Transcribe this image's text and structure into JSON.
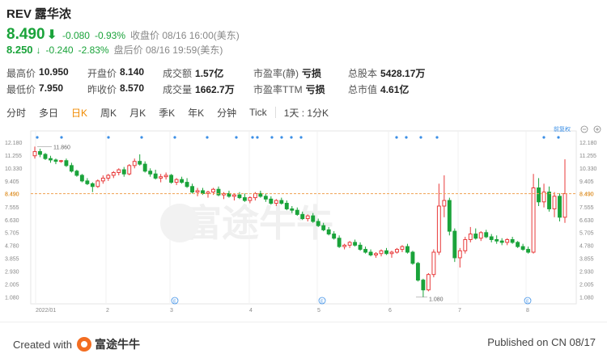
{
  "header": {
    "ticker": "REV",
    "name": "露华浓"
  },
  "quote": {
    "price": "8.490",
    "arrow": "⬇",
    "change": "-0.080",
    "change_pct": "-0.93%",
    "close_label": "收盘价 08/16 16:00(美东)",
    "ah_price": "8.250",
    "ah_arrow": "↓",
    "ah_change": "-0.240",
    "ah_change_pct": "-2.83%",
    "ah_label": "盘后价 08/16 19:59(美东)"
  },
  "stats": {
    "high_label": "最高价",
    "high": "10.950",
    "low_label": "最低价",
    "low": "7.950",
    "open_label": "开盘价",
    "open": "8.140",
    "prev_label": "昨收价",
    "prev": "8.570",
    "turnover_label": "成交额",
    "turnover": "1.57亿",
    "volume_label": "成交量",
    "volume": "1662.7万",
    "pe_static_label": "市盈率(静)",
    "pe_static": "亏损",
    "pe_ttm_label": "市盈率TTM",
    "pe_ttm": "亏损",
    "shares_label": "总股本",
    "shares": "5428.17万",
    "mcap_label": "总市值",
    "mcap": "4.61亿"
  },
  "tabs": [
    "分时",
    "多日",
    "日K",
    "周K",
    "月K",
    "季K",
    "年K",
    "分钟",
    "Tick",
    "1天 : 1分K"
  ],
  "active_tab": "日K",
  "colors": {
    "up": "#e83a3a",
    "down": "#1aa33a",
    "ref_line": "#f0a050",
    "accent": "#f08a00"
  },
  "chart_data": {
    "type": "candlestick",
    "y_ticks": [
      "12.180",
      "11.255",
      "10.330",
      "9.405",
      "8.490",
      "7.555",
      "6.630",
      "5.705",
      "4.780",
      "3.855",
      "2.930",
      "2.005",
      "1.080"
    ],
    "ylim": [
      0.6,
      12.4
    ],
    "x_labels": [
      "2022/01",
      "2",
      "3",
      "4",
      "5",
      "6",
      "7",
      "8"
    ],
    "current_price": 8.49,
    "current_price_label": "8.490",
    "max_annotation": "11.860",
    "min_annotation": "1.080",
    "adjust_label": "前复权",
    "event_marker_symbol": "E",
    "ohlc": [
      [
        11.2,
        11.86,
        11.0,
        11.5
      ],
      [
        11.5,
        11.7,
        11.1,
        11.3
      ],
      [
        11.3,
        11.4,
        10.9,
        11.0
      ],
      [
        11.0,
        11.2,
        10.7,
        10.9
      ],
      [
        10.9,
        11.0,
        10.6,
        10.8
      ],
      [
        10.8,
        10.9,
        10.7,
        10.85
      ],
      [
        10.85,
        11.0,
        10.4,
        10.5
      ],
      [
        10.5,
        10.7,
        10.0,
        10.1
      ],
      [
        10.1,
        10.2,
        9.7,
        9.8
      ],
      [
        9.8,
        9.9,
        9.3,
        9.4
      ],
      [
        9.4,
        9.6,
        9.1,
        9.2
      ],
      [
        9.2,
        9.3,
        8.6,
        9.0
      ],
      [
        9.0,
        9.5,
        8.9,
        9.4
      ],
      [
        9.4,
        9.8,
        9.2,
        9.6
      ],
      [
        9.6,
        9.9,
        9.4,
        9.8
      ],
      [
        9.8,
        10.1,
        9.6,
        10.0
      ],
      [
        10.0,
        10.3,
        9.8,
        10.2
      ],
      [
        10.2,
        10.4,
        9.7,
        9.9
      ],
      [
        9.9,
        10.6,
        9.8,
        10.5
      ],
      [
        10.5,
        11.0,
        10.3,
        10.8
      ],
      [
        10.8,
        11.3,
        10.5,
        10.6
      ],
      [
        10.6,
        10.8,
        10.0,
        10.1
      ],
      [
        10.1,
        10.3,
        9.7,
        9.9
      ],
      [
        9.9,
        10.2,
        9.5,
        9.6
      ],
      [
        9.6,
        9.9,
        9.3,
        9.7
      ],
      [
        9.7,
        10.0,
        9.5,
        9.8
      ],
      [
        9.8,
        9.9,
        9.2,
        9.3
      ],
      [
        9.3,
        9.6,
        9.1,
        9.5
      ],
      [
        9.5,
        9.7,
        9.2,
        9.3
      ],
      [
        9.3,
        9.6,
        8.9,
        9.0
      ],
      [
        9.0,
        9.2,
        8.5,
        8.6
      ],
      [
        8.6,
        8.9,
        8.3,
        8.7
      ],
      [
        8.7,
        8.9,
        8.4,
        8.5
      ],
      [
        8.5,
        8.7,
        8.2,
        8.6
      ],
      [
        8.6,
        8.9,
        8.4,
        8.8
      ],
      [
        8.8,
        9.0,
        8.3,
        8.4
      ],
      [
        8.4,
        8.6,
        8.1,
        8.5
      ],
      [
        8.5,
        8.7,
        8.2,
        8.3
      ],
      [
        8.3,
        8.5,
        8.0,
        8.4
      ],
      [
        8.4,
        8.6,
        8.1,
        8.2
      ],
      [
        8.2,
        8.5,
        7.9,
        8.0
      ],
      [
        8.0,
        8.3,
        7.8,
        8.2
      ],
      [
        8.2,
        8.6,
        8.0,
        8.5
      ],
      [
        8.5,
        8.7,
        8.2,
        8.3
      ],
      [
        8.3,
        8.5,
        7.9,
        8.1
      ],
      [
        8.1,
        8.3,
        7.7,
        7.8
      ],
      [
        7.8,
        8.1,
        7.6,
        8.0
      ],
      [
        8.0,
        8.2,
        7.7,
        7.8
      ],
      [
        7.8,
        8.0,
        7.3,
        7.4
      ],
      [
        7.4,
        7.6,
        7.1,
        7.3
      ],
      [
        7.3,
        7.5,
        6.9,
        7.0
      ],
      [
        7.0,
        7.2,
        6.6,
        6.7
      ],
      [
        6.7,
        7.0,
        6.5,
        6.9
      ],
      [
        6.9,
        7.1,
        6.4,
        6.5
      ],
      [
        6.5,
        6.7,
        6.1,
        6.2
      ],
      [
        6.2,
        6.4,
        5.8,
        5.9
      ],
      [
        5.9,
        6.1,
        5.5,
        5.6
      ],
      [
        5.6,
        5.8,
        5.2,
        5.3
      ],
      [
        5.3,
        5.5,
        4.6,
        4.7
      ],
      [
        4.7,
        4.9,
        4.5,
        4.8
      ],
      [
        4.8,
        5.1,
        4.6,
        5.0
      ],
      [
        5.0,
        5.2,
        4.7,
        4.8
      ],
      [
        4.8,
        5.0,
        4.4,
        4.5
      ],
      [
        4.5,
        4.7,
        4.2,
        4.3
      ],
      [
        4.3,
        4.5,
        4.0,
        4.1
      ],
      [
        4.1,
        4.3,
        3.9,
        4.2
      ],
      [
        4.2,
        4.5,
        4.0,
        4.4
      ],
      [
        4.4,
        4.6,
        4.1,
        4.2
      ],
      [
        4.2,
        4.4,
        3.9,
        4.3
      ],
      [
        4.3,
        4.6,
        4.2,
        4.5
      ],
      [
        4.5,
        4.8,
        4.3,
        4.7
      ],
      [
        4.7,
        4.9,
        4.2,
        4.3
      ],
      [
        4.3,
        4.4,
        3.4,
        3.5
      ],
      [
        3.5,
        3.6,
        2.2,
        2.3
      ],
      [
        2.3,
        2.4,
        1.08,
        1.6
      ],
      [
        1.6,
        2.8,
        1.5,
        2.7
      ],
      [
        2.7,
        4.5,
        2.5,
        4.3
      ],
      [
        4.3,
        9.2,
        4.1,
        7.6
      ],
      [
        7.6,
        9.8,
        6.8,
        8.0
      ],
      [
        8.0,
        8.2,
        5.5,
        5.8
      ],
      [
        5.8,
        6.0,
        3.6,
        3.9
      ],
      [
        3.9,
        4.6,
        3.2,
        4.4
      ],
      [
        4.4,
        5.4,
        4.2,
        5.2
      ],
      [
        5.2,
        6.1,
        5.0,
        5.6
      ],
      [
        5.6,
        6.0,
        5.2,
        5.3
      ],
      [
        5.3,
        5.8,
        5.1,
        5.7
      ],
      [
        5.7,
        5.9,
        5.3,
        5.4
      ],
      [
        5.4,
        5.6,
        5.0,
        5.2
      ],
      [
        5.2,
        5.5,
        4.9,
        5.1
      ],
      [
        5.1,
        5.3,
        4.8,
        5.0
      ],
      [
        5.0,
        5.3,
        4.8,
        5.2
      ],
      [
        5.2,
        5.4,
        4.9,
        5.0
      ],
      [
        5.0,
        5.1,
        4.6,
        4.7
      ],
      [
        4.7,
        4.9,
        4.4,
        4.5
      ],
      [
        4.5,
        4.7,
        4.2,
        4.3
      ],
      [
        4.3,
        9.9,
        4.2,
        8.9
      ],
      [
        8.9,
        9.6,
        7.6,
        7.9
      ],
      [
        7.9,
        9.2,
        7.5,
        8.6
      ],
      [
        8.6,
        9.0,
        7.2,
        7.4
      ],
      [
        7.4,
        8.6,
        6.8,
        8.3
      ],
      [
        8.3,
        8.5,
        6.5,
        6.8
      ],
      [
        6.8,
        10.95,
        6.4,
        8.49
      ]
    ]
  }
}
